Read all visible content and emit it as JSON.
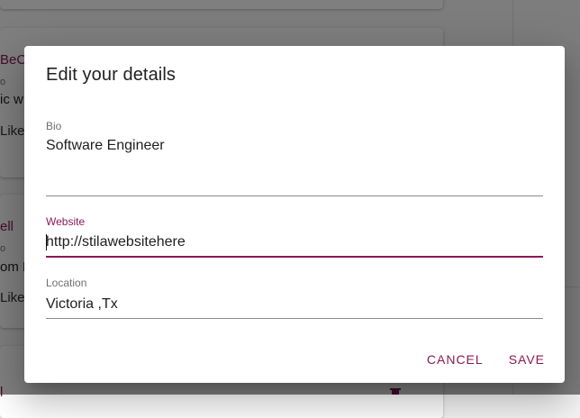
{
  "background": {
    "cards": [
      {
        "handle": "BeC",
        "meta": "o",
        "text": "ic w",
        "likes": "Like"
      },
      {
        "handle": "ell",
        "meta": "o",
        "text": "om D",
        "likes": "Like"
      },
      {
        "handle": "l"
      }
    ]
  },
  "dialog": {
    "title": "Edit your details",
    "fields": {
      "bio": {
        "label": "Bio",
        "value": "Software Engineer"
      },
      "website": {
        "label": "Website",
        "value": "http://stilawebsitehere"
      },
      "location": {
        "label": "Location",
        "value": "Victoria ,Tx"
      }
    },
    "actions": {
      "cancel": "CANCEL",
      "save": "SAVE"
    }
  },
  "colors": {
    "accent": "#8a1a56",
    "overlay": "rgba(0,0,0,0.5)"
  },
  "icons": {
    "trash": "trash-icon"
  }
}
